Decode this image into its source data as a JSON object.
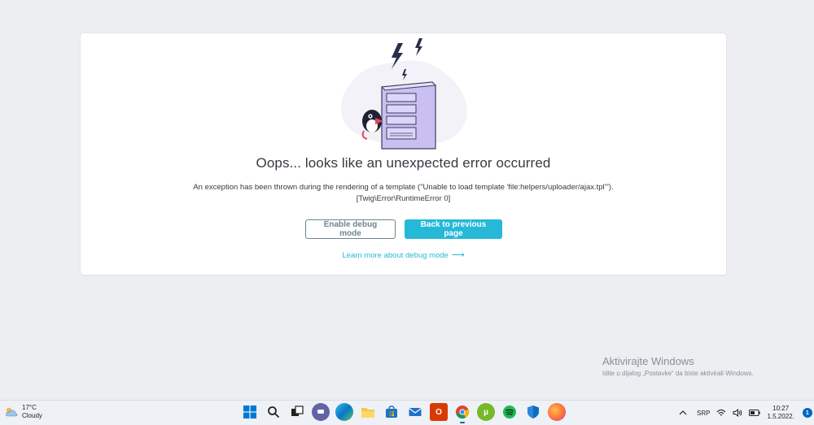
{
  "error_page": {
    "title": "Oops... looks like an unexpected error occurred",
    "message_line1": "An exception has been thrown during the rendering of a template (\"Unable to load template 'file:helpers/uploader/ajax.tpl'\").",
    "message_line2": "[Twig\\Error\\RuntimeError 0]",
    "debug_button": "Enable debug mode",
    "back_button": "Back to previous page",
    "learn_link": "Learn more about debug mode",
    "colors": {
      "accent": "#25b9d7",
      "outline": "#6c868e",
      "illustration": "#c9bff0"
    }
  },
  "watermark": {
    "title": "Aktivirajte Windows",
    "subtitle": "Idite u dijalog „Postavke“ da biste aktivirali Windows."
  },
  "taskbar": {
    "weather": {
      "temp": "17°C",
      "condition": "Cloudy",
      "icon": "cloud-sun-icon"
    },
    "apps": [
      {
        "icon": "windows-start-icon"
      },
      {
        "icon": "search-icon"
      },
      {
        "icon": "task-view-icon"
      },
      {
        "icon": "chat-icon"
      },
      {
        "icon": "edge-icon"
      },
      {
        "icon": "file-explorer-icon"
      },
      {
        "icon": "store-icon"
      },
      {
        "icon": "mail-icon"
      },
      {
        "icon": "office-icon"
      },
      {
        "icon": "chrome-icon"
      },
      {
        "icon": "utorrent-icon"
      },
      {
        "icon": "spotify-icon"
      },
      {
        "icon": "defender-icon"
      },
      {
        "icon": "firefox-icon"
      }
    ],
    "tray": {
      "language": "SRP",
      "time": "10:27",
      "date": "1.5.2022.",
      "notification_count": "1"
    }
  }
}
